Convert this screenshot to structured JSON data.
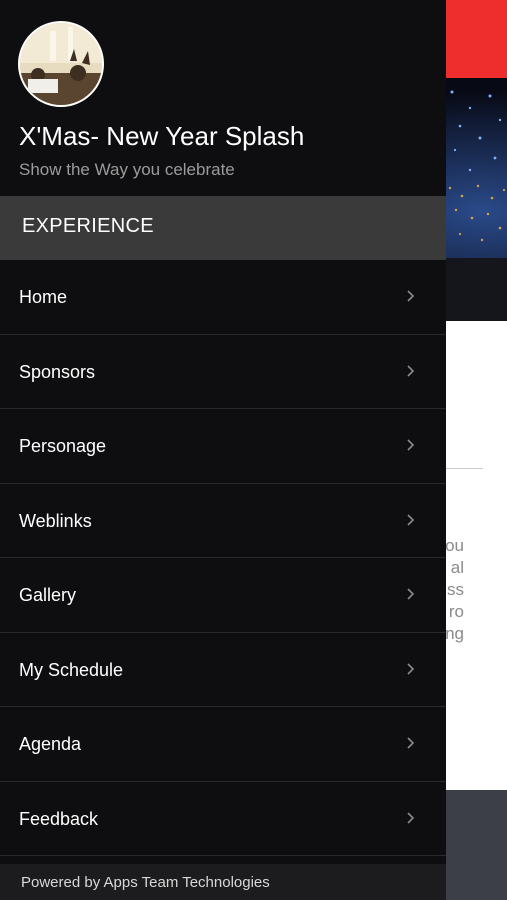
{
  "background": {
    "peek_text_lines": [
      "ou",
      "al",
      "ss",
      "ro",
      "ng"
    ]
  },
  "drawer": {
    "app_title": "X'Mas- New Year Splash",
    "app_subtitle": "Show the Way you celebrate",
    "section_header": "EXPERIENCE",
    "menu_items": [
      {
        "label": "Home",
        "icon": "chevron-right-icon"
      },
      {
        "label": "Sponsors",
        "icon": "chevron-right-icon"
      },
      {
        "label": "Personage",
        "icon": "chevron-right-icon"
      },
      {
        "label": "Weblinks",
        "icon": "chevron-right-icon"
      },
      {
        "label": "Gallery",
        "icon": "chevron-right-icon"
      },
      {
        "label": "My Schedule",
        "icon": "chevron-right-icon"
      },
      {
        "label": "Agenda",
        "icon": "chevron-right-icon"
      },
      {
        "label": "Feedback",
        "icon": "chevron-right-icon"
      }
    ],
    "footer": "Powered by Apps Team Technologies"
  },
  "colors": {
    "drawer_bg": "#0e0e10",
    "section_header_bg": "#3a3a3a",
    "accent_red": "#ee2d2d",
    "subtitle_gray": "#9b9b9b"
  }
}
